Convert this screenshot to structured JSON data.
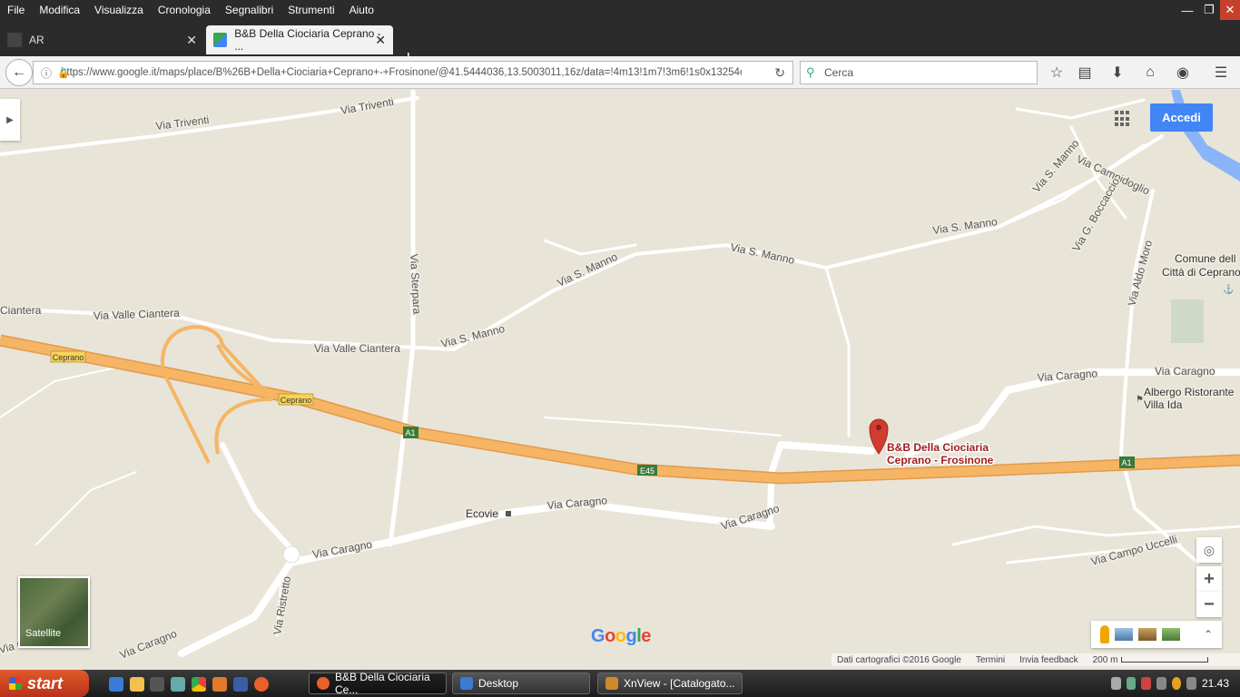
{
  "menubar": {
    "items": [
      "File",
      "Modifica",
      "Visualizza",
      "Cronologia",
      "Segnalibri",
      "Strumenti",
      "Aiuto"
    ]
  },
  "tabs": [
    {
      "title": "AR",
      "active": false
    },
    {
      "title": "B&B Della Ciociaria Ceprano - ...",
      "active": true
    }
  ],
  "nav": {
    "url": "https://www.google.it/maps/place/B%26B+Della+Ciociaria+Ceprano+-+Frosinone/@41.5444036,13.5003011,16z/data=!4m13!1m7!3m6!1s0x13254cf1ab",
    "search_placeholder": "Cerca"
  },
  "map": {
    "signin_label": "Accedi",
    "place_name_line1": "B&B Della Ciociaria",
    "place_name_line2": "Ceprano - Frosinone",
    "satellite_label": "Satellite",
    "logo": "Google",
    "attribution": "Dati cartografici ©2016 Google",
    "terms": "Termini",
    "feedback": "Invia feedback",
    "scale": "200 m",
    "street_labels": {
      "via_triventi": "Via Triventi",
      "via_campidoglio": "Via Campidoglio",
      "via_s_manno": "Via S. Manno",
      "via_g_boccaccio": "Via G. Boccaccio",
      "via_aldo_moro": "Via Aldo Moro",
      "via_sterpara": "Via Sterpara",
      "ciantera": "Ciantera",
      "via_valle_ciantera": "Via Valle Ciantera",
      "via_caragno": "Via Caragno",
      "via_campo_uccelli": "Via Campo Uccelli",
      "via_ristretto": "Via Ristretto",
      "via_ca": "Via Ca"
    },
    "road_shields": {
      "ceprano": "Ceprano",
      "a1": "A1",
      "e45": "E45"
    },
    "poi": {
      "comune_line1": "Comune dell",
      "comune_line2": "Città di Ceprano",
      "albergo_line1": "Albergo Ristorante",
      "albergo_line2": "Villa Ida",
      "ecovie": "Ecovie"
    }
  },
  "taskbar": {
    "start_label": "start",
    "windows": [
      {
        "title": "B&B Della Ciociaria Ce...",
        "active": true
      },
      {
        "title": "Desktop",
        "active": false
      },
      {
        "title": "XnView - [Catalogato...",
        "active": false
      }
    ],
    "clock": "21.43"
  },
  "colors": {
    "highway": "#f5b565",
    "highway_border": "#e39a4a",
    "road": "#ffffff",
    "land": "#e8e4d8",
    "water": "#8ab4f8",
    "accent": "#4285f4",
    "pin": "#d23b30"
  }
}
